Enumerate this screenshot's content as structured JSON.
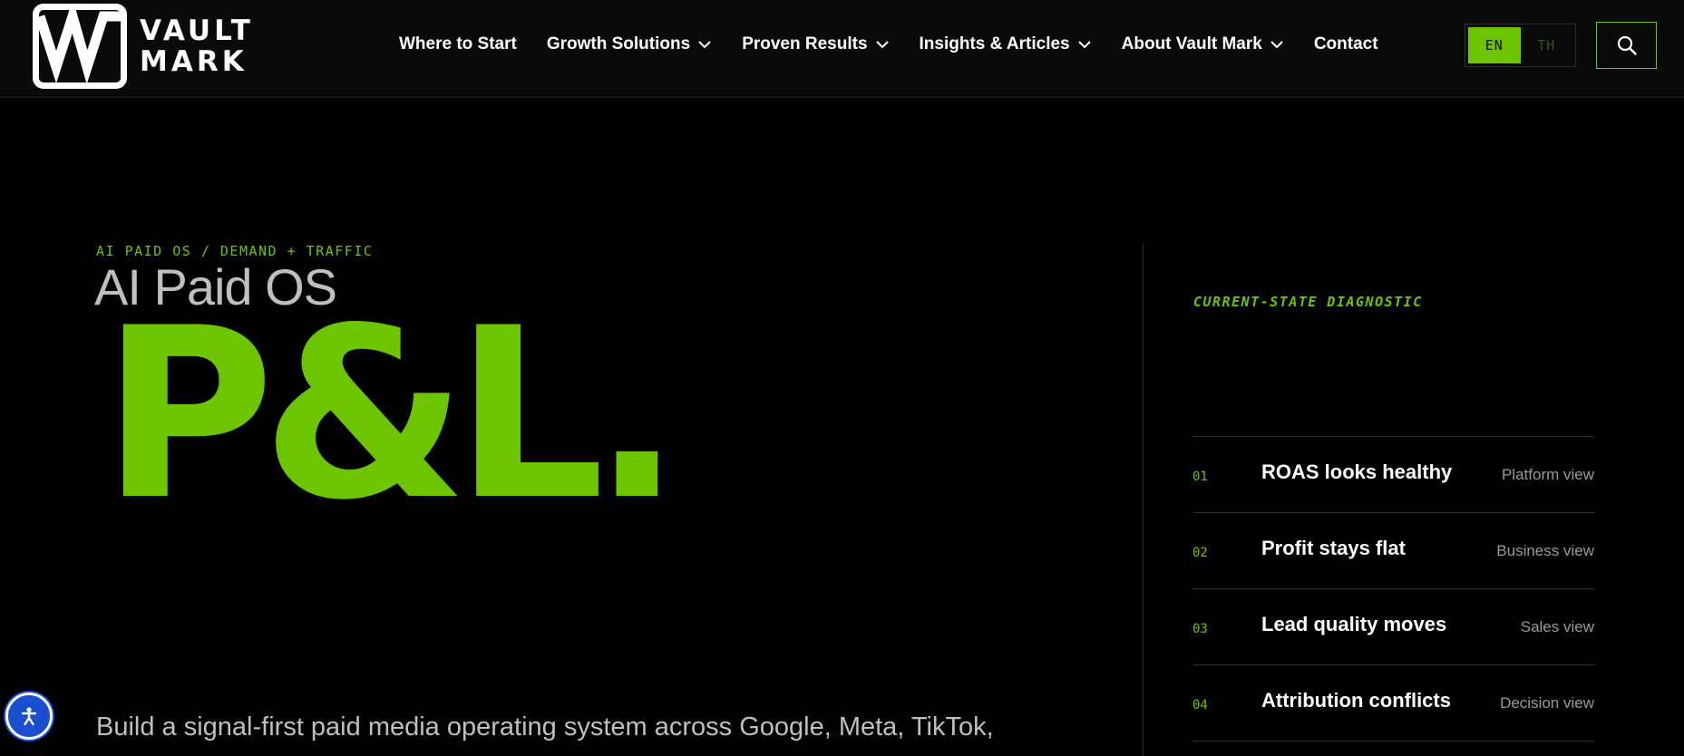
{
  "brand": {
    "name_line1": "VAULT",
    "name_line2": "MARK",
    "logo_icon": "vm-monogram-icon"
  },
  "nav": {
    "items": [
      {
        "label": "Where to Start",
        "has_dropdown": false
      },
      {
        "label": "Growth Solutions",
        "has_dropdown": true
      },
      {
        "label": "Proven Results",
        "has_dropdown": true
      },
      {
        "label": "Insights & Articles",
        "has_dropdown": true
      },
      {
        "label": "About Vault Mark",
        "has_dropdown": true
      },
      {
        "label": "Contact",
        "has_dropdown": false
      }
    ]
  },
  "language": {
    "options": [
      "EN",
      "TH"
    ],
    "selected": "EN"
  },
  "search": {
    "icon": "search-icon"
  },
  "hero": {
    "eyebrow": "AI PAID OS / DEMAND + TRAFFIC",
    "subtitle": "AI Paid OS",
    "headline": "P&L.",
    "description": "Build a signal-first paid media operating system across Google, Meta, TikTok,"
  },
  "diagnostic": {
    "label": "CURRENT-STATE DIAGNOSTIC",
    "rows": [
      {
        "num": "01",
        "title": "ROAS looks healthy",
        "view": "Platform view"
      },
      {
        "num": "02",
        "title": "Profit stays flat",
        "view": "Business view"
      },
      {
        "num": "03",
        "title": "Lead quality moves",
        "view": "Sales view"
      },
      {
        "num": "04",
        "title": "Attribution conflicts",
        "view": "Decision view"
      }
    ]
  },
  "accessibility": {
    "icon": "accessibility-icon"
  },
  "colors": {
    "accent": "#6cc500",
    "background": "#000000",
    "header_bg": "#0a0a0a",
    "muted_text": "#bfbfbf",
    "accessibility_blue": "#1a4fd1"
  }
}
